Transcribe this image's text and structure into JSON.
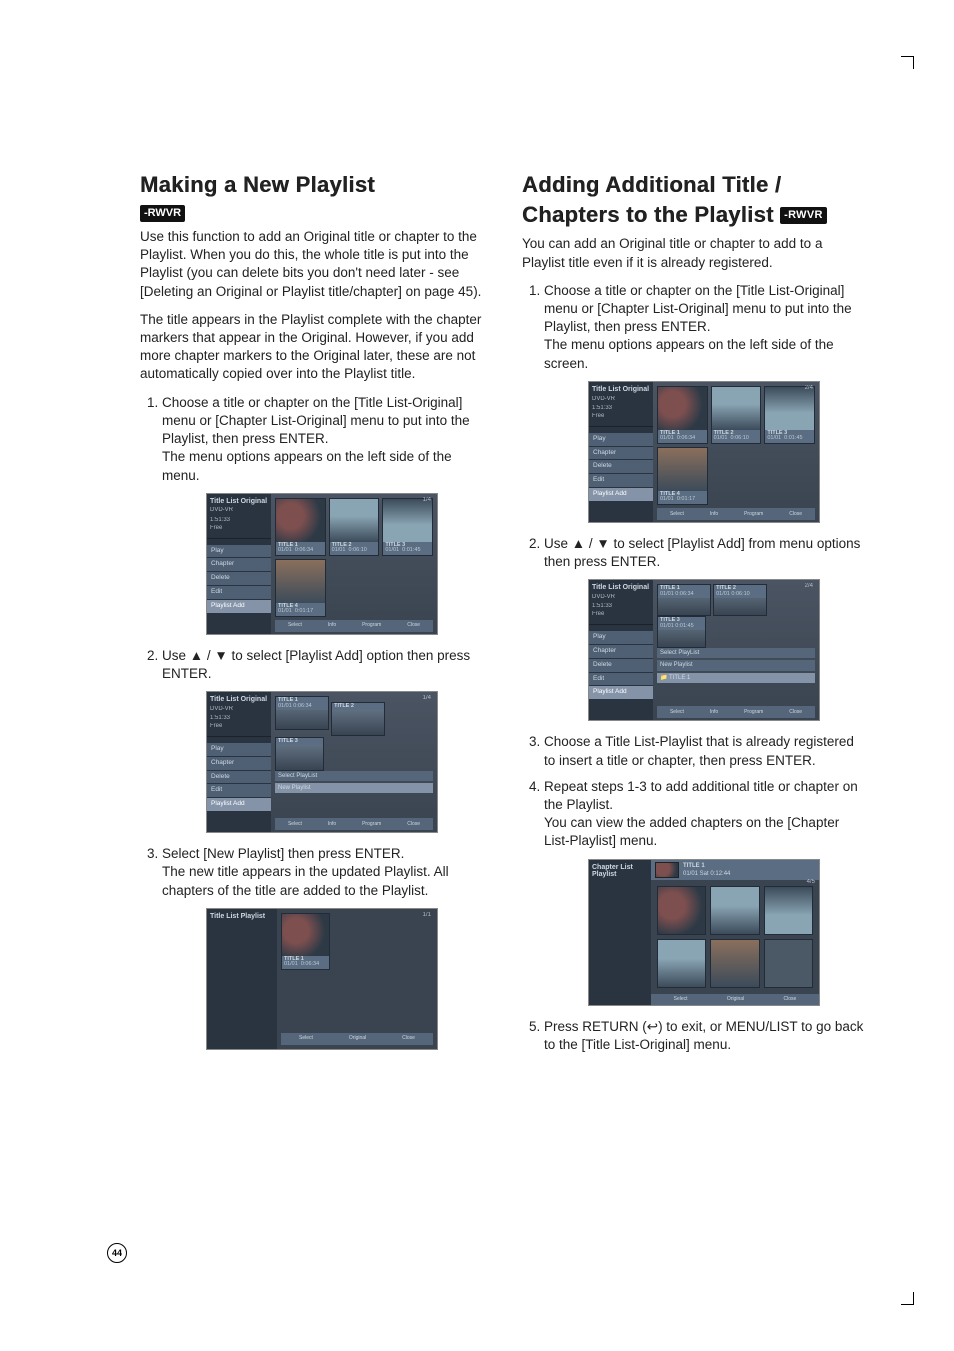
{
  "page_number": "44",
  "badges": {
    "rwvr": "-RWVR"
  },
  "left": {
    "heading": "Making a New Playlist",
    "intro": "Use this function to add an Original title or chapter to the Playlist. When you do this, the whole title is put into the Playlist (you can delete bits you don't need later - see [Deleting an Original or Playlist title/chapter] on page 45).",
    "intro2": "The title appears in the Playlist complete with the chapter markers that appear in the Original. However, if you add more chapter markers to the Original later, these are not automatically copied over into the Playlist title.",
    "step1_a": "Choose a title or chapter on the [Title List-Original] menu or [Chapter List-Original] menu to put into the Playlist, then press ENTER.",
    "step1_b": "The menu options appears on the left side of the menu.",
    "step2": "Use ▲ / ▼ to select [Playlist Add] option then press ENTER.",
    "step3_a": "Select [New Playlist] then press ENTER.",
    "step3_b": "The new title appears in the updated Playlist. All chapters of the title are added to the Playlist."
  },
  "right": {
    "heading": "Adding Additional Title / Chapters to the Playlist",
    "intro": "You can add an Original title or chapter to add to a Playlist title even if it is already registered.",
    "step1_a": "Choose a title or chapter on the [Title List-Original] menu or [Chapter List-Original] menu to put into the Playlist, then press ENTER.",
    "step1_b": "The menu options appears on the left side of the screen.",
    "step2": "Use ▲ / ▼ to select [Playlist Add] from menu options then press ENTER.",
    "step3": "Choose a Title List-Playlist that is already registered to insert a title or chapter, then press ENTER.",
    "step4_a": "Repeat steps 1-3 to add additional title or chapter on the Playlist.",
    "step4_b": "You can view the added chapters on the [Chapter List-Playlist] menu.",
    "step5": "Press RETURN (↩) to exit, or MENU/LIST to go back to the [Title List-Original] menu."
  },
  "shots": {
    "titlelist_original": {
      "header": "Title List Original",
      "disc": "DVD-VR",
      "rec": "1:51:33",
      "free": "Free",
      "count": "1/4",
      "menu": [
        "Play",
        "Chapter",
        "Delete",
        "Edit",
        "Playlist Add"
      ],
      "bottom": [
        "Select",
        "Info",
        "Program",
        "Close"
      ],
      "titles": [
        {
          "name": "TITLE 1",
          "date": "01/01",
          "dur": "0:06:34"
        },
        {
          "name": "TITLE 2",
          "date": "01/01",
          "dur": "0:06:10"
        },
        {
          "name": "TITLE 3",
          "date": "01/01",
          "dur": "0:01:45"
        },
        {
          "name": "TITLE 4",
          "date": "01/01",
          "dur": "0:01:17"
        }
      ]
    },
    "select_playlist": {
      "panel": "Select PlayList",
      "newpl": "New Playlist",
      "title1": "TITLE 1"
    },
    "playlist": {
      "header": "Title List Playlist",
      "count": "1/1",
      "titles": [
        {
          "name": "TITLE 1",
          "date": "01/01",
          "dur": "0:06:34"
        }
      ],
      "bottom": [
        "Select",
        "Original",
        "Close"
      ]
    },
    "chapterlist": {
      "header": "Chapter List Playlist",
      "title": "TITLE 1",
      "date": "01/01  Sat  0:12:44",
      "count": "4/5",
      "bottom": [
        "Select",
        "Original",
        "Close"
      ]
    },
    "count2": "2/4"
  }
}
